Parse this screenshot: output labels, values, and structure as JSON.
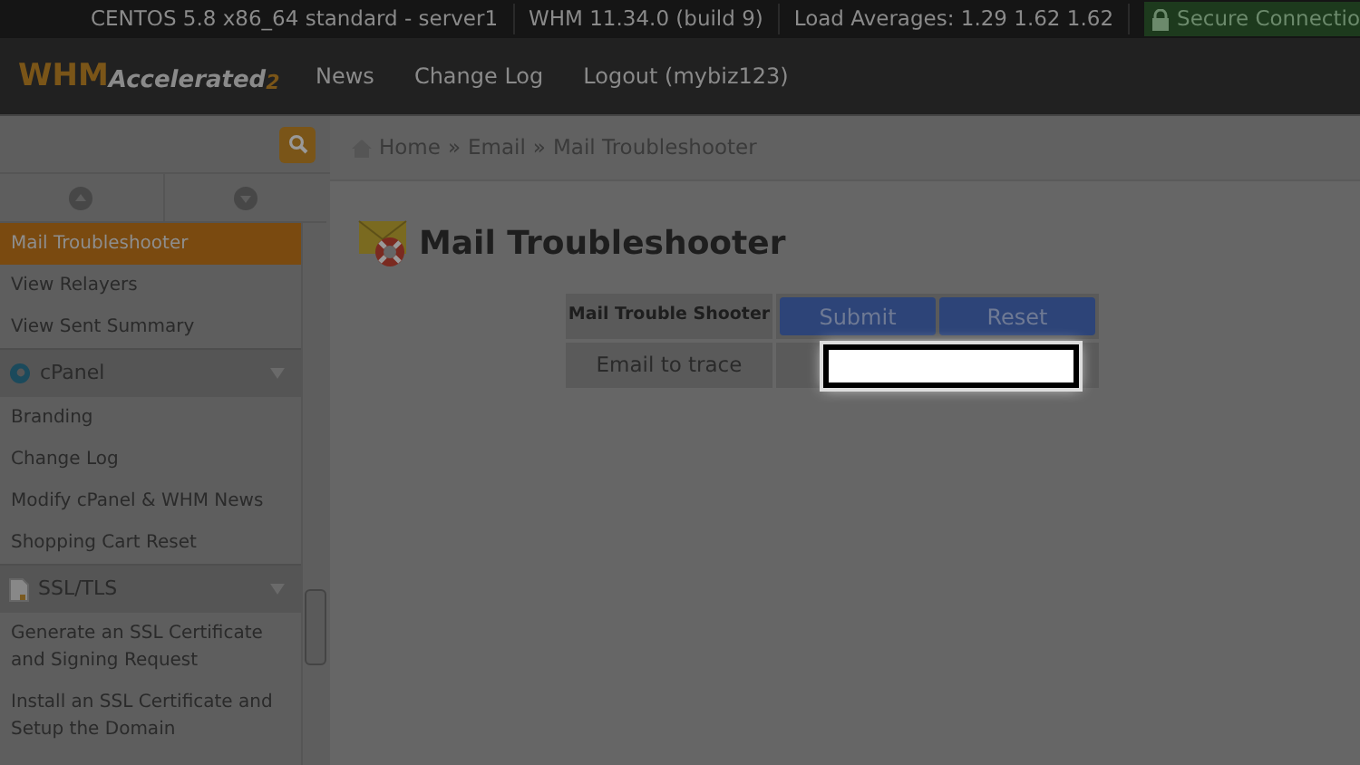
{
  "top_bar": {
    "items": [
      "CENTOS 5.8 x86_64 standard - server1",
      "WHM 11.34.0 (build 9)",
      "Load Averages: 1.29 1.62 1.62"
    ],
    "secure": "Secure Connectio"
  },
  "header": {
    "logo": "WHM",
    "logo_sub": "Accelerated",
    "logo_version": "2",
    "nav": [
      "News",
      "Change Log",
      "Logout (mybiz123)"
    ]
  },
  "sidebar": {
    "items": [
      {
        "kind": "item",
        "label": "Mail Troubleshooter",
        "selected": true
      },
      {
        "kind": "item",
        "label": "View Relayers",
        "selected": false
      },
      {
        "kind": "item",
        "label": "View Sent Summary",
        "selected": false
      },
      {
        "kind": "section",
        "label": "cPanel"
      },
      {
        "kind": "item",
        "label": "Branding",
        "selected": false
      },
      {
        "kind": "item",
        "label": "Change Log",
        "selected": false
      },
      {
        "kind": "item",
        "label": "Modify cPanel & WHM News",
        "selected": false
      },
      {
        "kind": "item",
        "label": "Shopping Cart Reset",
        "selected": false
      },
      {
        "kind": "section",
        "label": "SSL/TLS"
      },
      {
        "kind": "item",
        "label": "Generate an SSL Certificate and Signing Request",
        "selected": false
      },
      {
        "kind": "item",
        "label": "Install an SSL Certificate and Setup the Domain",
        "selected": false
      }
    ]
  },
  "breadcrumb": {
    "separator": "»",
    "items": [
      "Home",
      "Email",
      "Mail Troubleshooter"
    ]
  },
  "page_title": "Mail Troubleshooter",
  "form": {
    "heading": "Mail Trouble Shooter",
    "buttons": [
      "Submit",
      "Reset"
    ],
    "field_label": "Email to trace"
  }
}
